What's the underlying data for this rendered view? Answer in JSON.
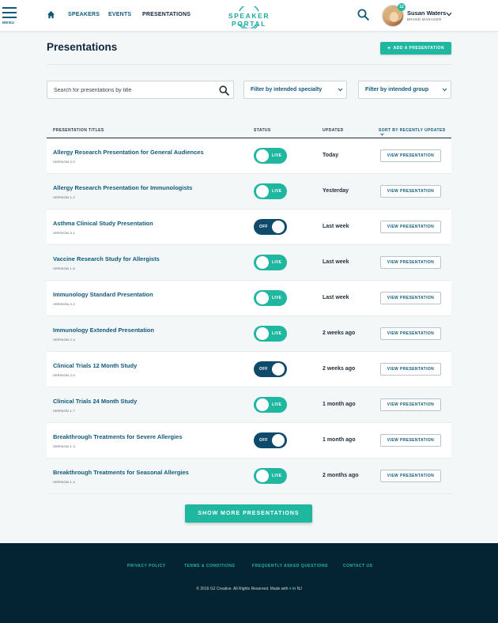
{
  "header": {
    "menu_label": "MENU",
    "nav": [
      {
        "label": "SPEAKERS"
      },
      {
        "label": "EVENTS"
      },
      {
        "label": "PRESENTATIONS"
      }
    ],
    "logo_text": "SPEAKER PORTAL",
    "notifications": "12",
    "user_name": "Susan Waters",
    "user_role": "BRAND MANAGER",
    "accent": "#1fb79f",
    "brand": "#0f5a7a"
  },
  "page": {
    "title": "Presentations",
    "add_label": "ADD A PRESENTATION",
    "search_placeholder": "Search for presentations by title",
    "filter_specialty": "Filter by intended specialty",
    "filter_group": "Filter by intended group"
  },
  "table": {
    "col_titles": "PRESENTATION TITLES",
    "col_status": "STATUS",
    "col_updated": "UPDATED",
    "sort_label": "SORT BY RECENTLY UPDATED",
    "view_label": "VIEW PRESENTATION",
    "rows": [
      {
        "title": "Allergy Research Presentation for General Audiences",
        "version": "VERSION 2.0",
        "status": "LIVE",
        "updated": "Today"
      },
      {
        "title": "Allergy Research Presentation for Immunologists",
        "version": "VERSION 1.2",
        "status": "LIVE",
        "updated": "Yesterday"
      },
      {
        "title": "Asthma Clinical Study Presentation",
        "version": "VERSION 3.1",
        "status": "OFF",
        "updated": "Last week"
      },
      {
        "title": "Vaccine Research Study for Allergists",
        "version": "VERSION 1.5",
        "status": "LIVE",
        "updated": "Last week"
      },
      {
        "title": "Immunology Standard Presentation",
        "version": "VERSION 2.2",
        "status": "LIVE",
        "updated": "Last week"
      },
      {
        "title": "Immunology Extended Presentation",
        "version": "VERSION 2.4",
        "status": "LIVE",
        "updated": "2 weeks ago"
      },
      {
        "title": "Clinical Trials 12 Month Study",
        "version": "VERSION 2.0",
        "status": "OFF",
        "updated": "2 weeks ago"
      },
      {
        "title": "Clinical Trials 24 Month Study",
        "version": "VERSION 1.7",
        "status": "LIVE",
        "updated": "1 month ago"
      },
      {
        "title": "Breakthrough Treatments for Severe Allergies",
        "version": "VERSION 1.3",
        "status": "OFF",
        "updated": "1 month ago"
      },
      {
        "title": "Breakthrough Treatments for Seasonal Allergies",
        "version": "VERSION 1.4",
        "status": "LIVE",
        "updated": "2 months ago"
      }
    ],
    "more_label": "SHOW MORE PRESENTATIONS"
  },
  "footer": {
    "links": [
      {
        "label": "PRIVACY POLICY"
      },
      {
        "label": "TERMS & CONDITIONS"
      },
      {
        "label": "FREQUENTLY ASKED QUESTIONS"
      },
      {
        "label": "CONTACT US"
      }
    ],
    "copy_before": "© 2016 G2 Creative.  All Rights Reserved.  Made with",
    "copy_after": "in NJ"
  }
}
